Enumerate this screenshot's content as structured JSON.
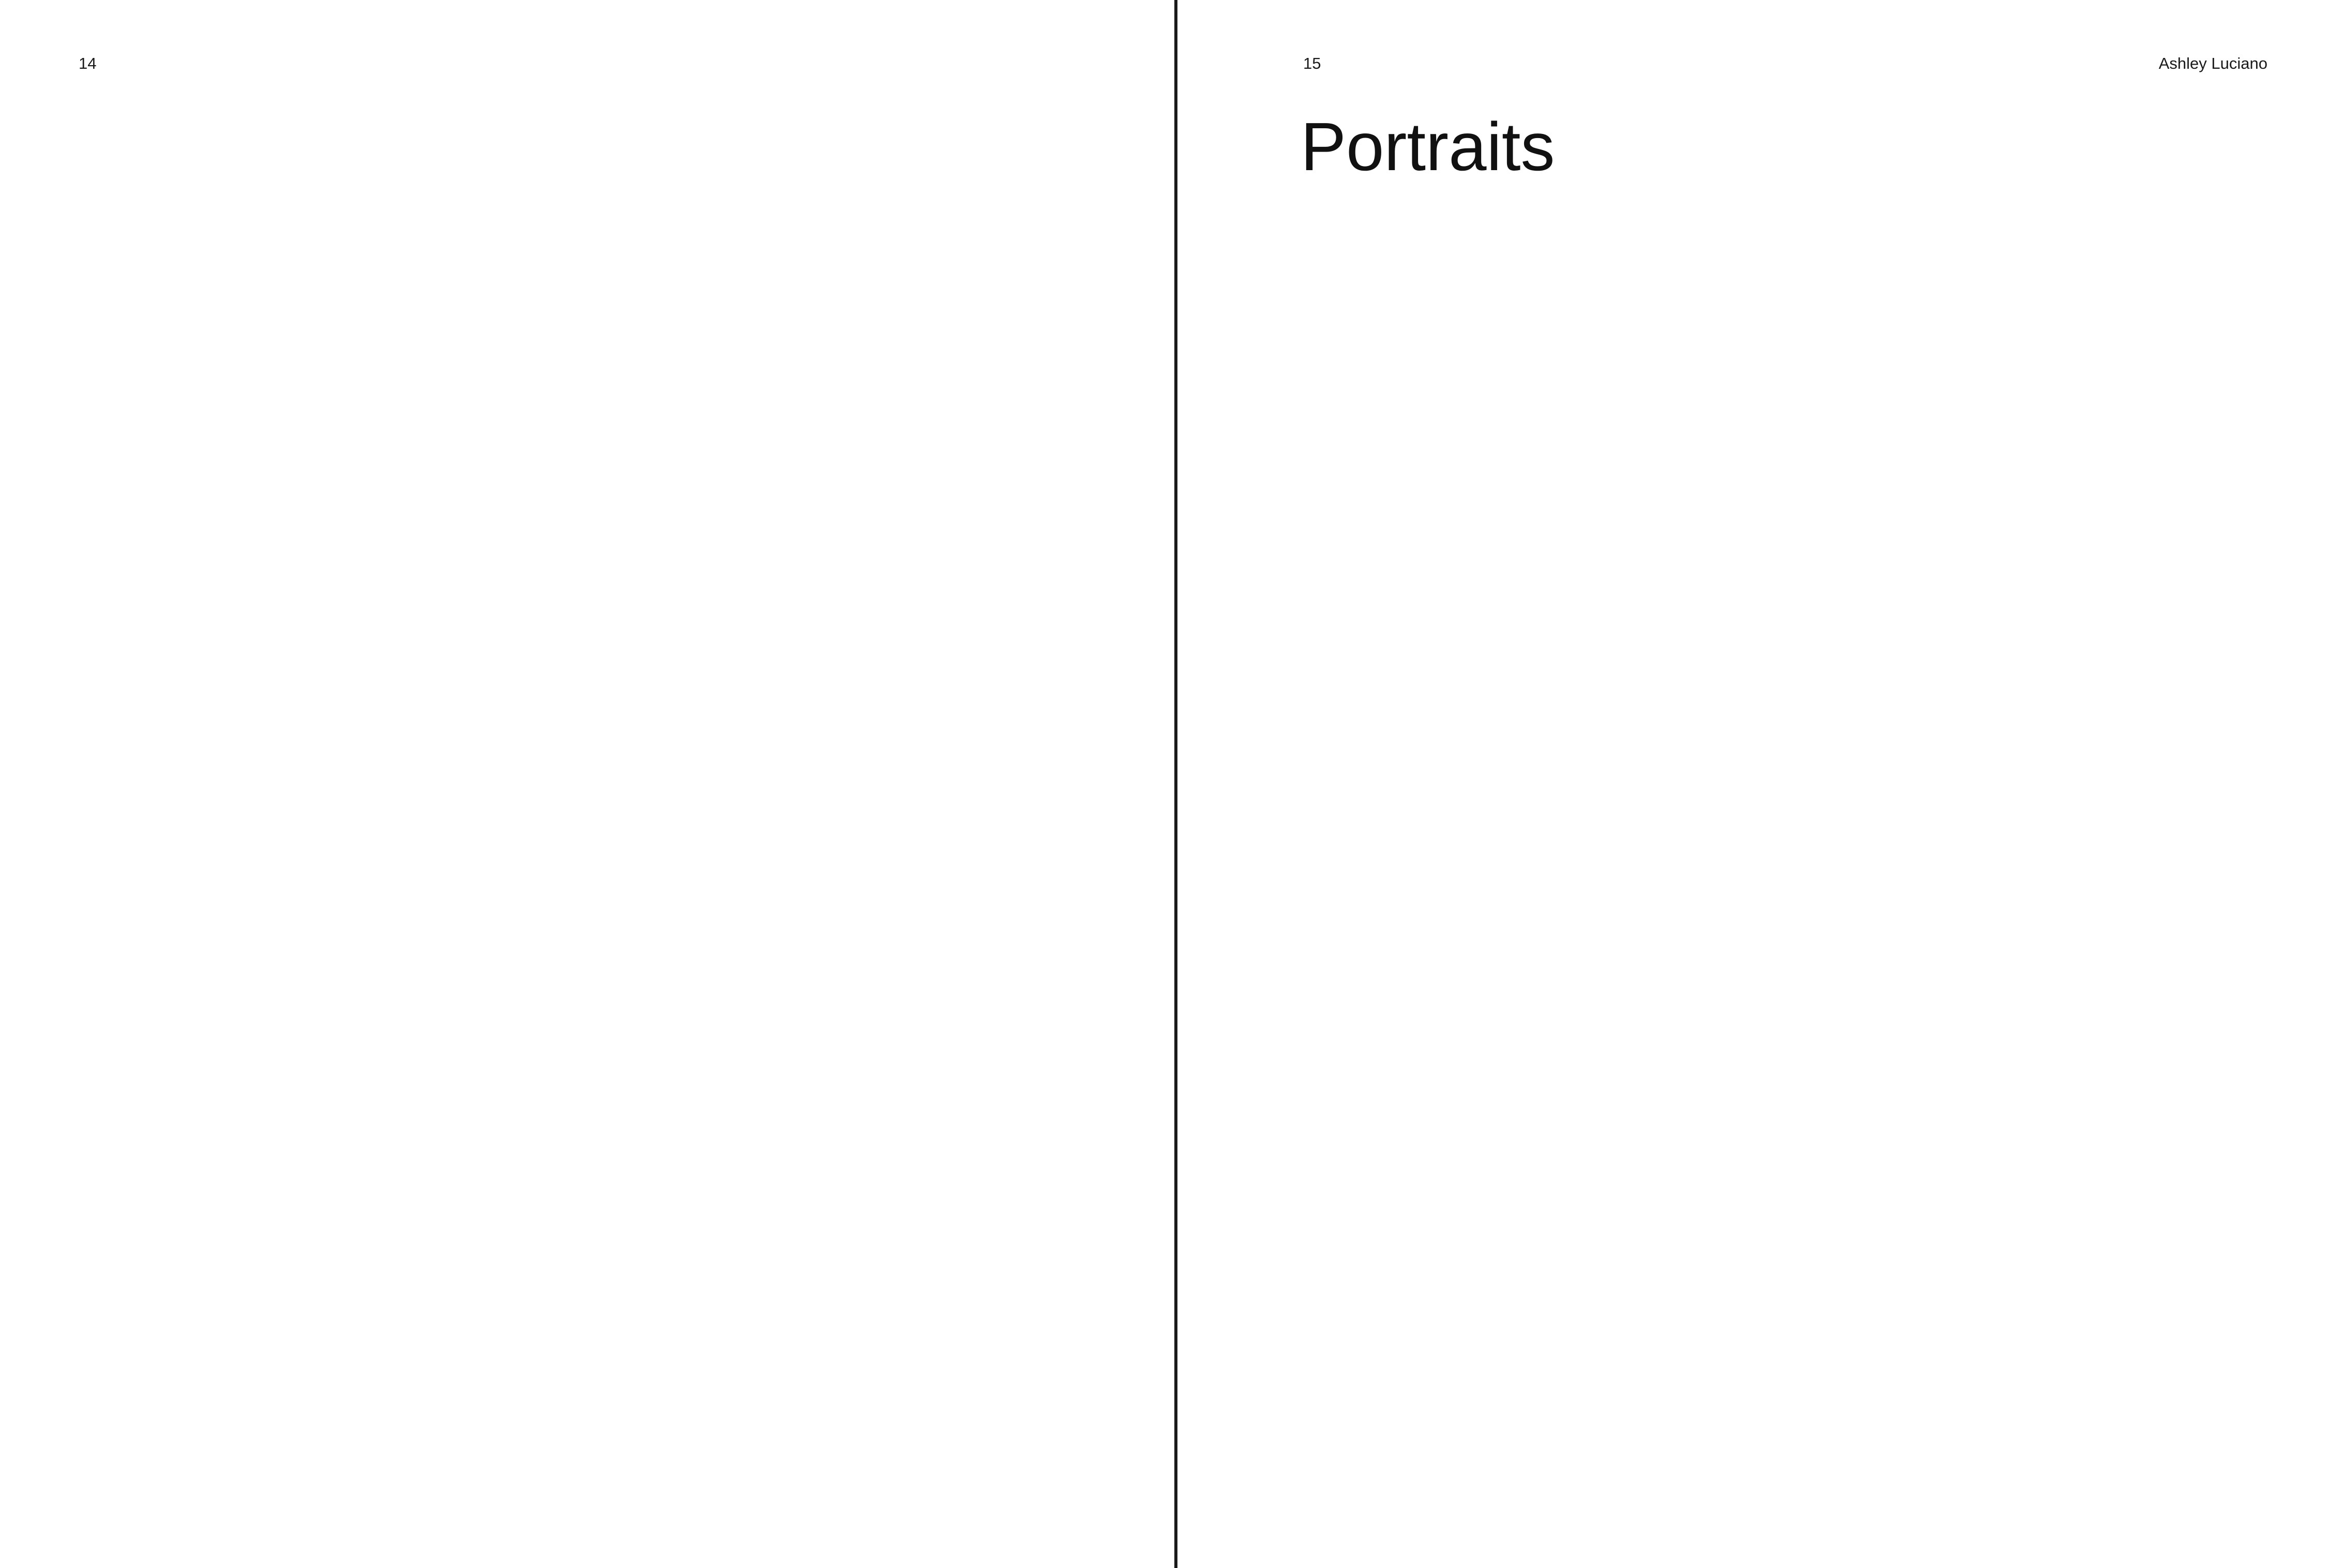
{
  "spread": {
    "left_page": {
      "page_number": "14"
    },
    "right_page": {
      "page_number": "15",
      "running_head": "Ashley Luciano",
      "section_title": "Portraits"
    }
  }
}
